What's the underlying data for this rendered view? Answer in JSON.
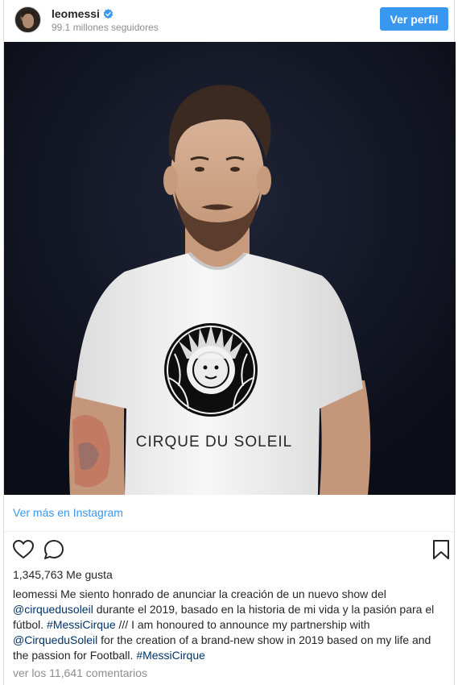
{
  "header": {
    "username": "leomessi",
    "followers": "99.1 millones seguidores",
    "view_profile": "Ver perfil"
  },
  "photo": {
    "shirt_text": "CIRQUE DU SOLEIL"
  },
  "colors": {
    "accent": "#3897f0",
    "background": "#ffffff",
    "photo_bg": "#111420",
    "link": "#3897f0",
    "hashtag": "#003569",
    "muted": "#8e8e8e"
  },
  "links": {
    "view_more": "Ver más en Instagram"
  },
  "icons": {
    "like": "heart-icon",
    "comment": "comment-icon",
    "save": "bookmark-icon",
    "verified": "verified-badge-icon"
  },
  "likes": "1,345,763 Me gusta",
  "caption": {
    "username": "leomessi",
    "text_1": " Me siento honrado de anunciar la creación de un nuevo show del ",
    "mention_1": "@cirquedusoleil",
    "text_2": " durante el 2019, basado en la historia de mi vida y la pasión para el fútbol. ",
    "hashtag_1": "#MessiCirque",
    "text_3": " /// I am honoured to announce my partnership with ",
    "mention_2": "@CirqueduSoleil",
    "text_4": " for the creation of a brand-new show in 2019 based on my life and the passion for Football. ",
    "hashtag_2": "#MessiCirque"
  },
  "comments": "ver los 11,641 comentarios"
}
